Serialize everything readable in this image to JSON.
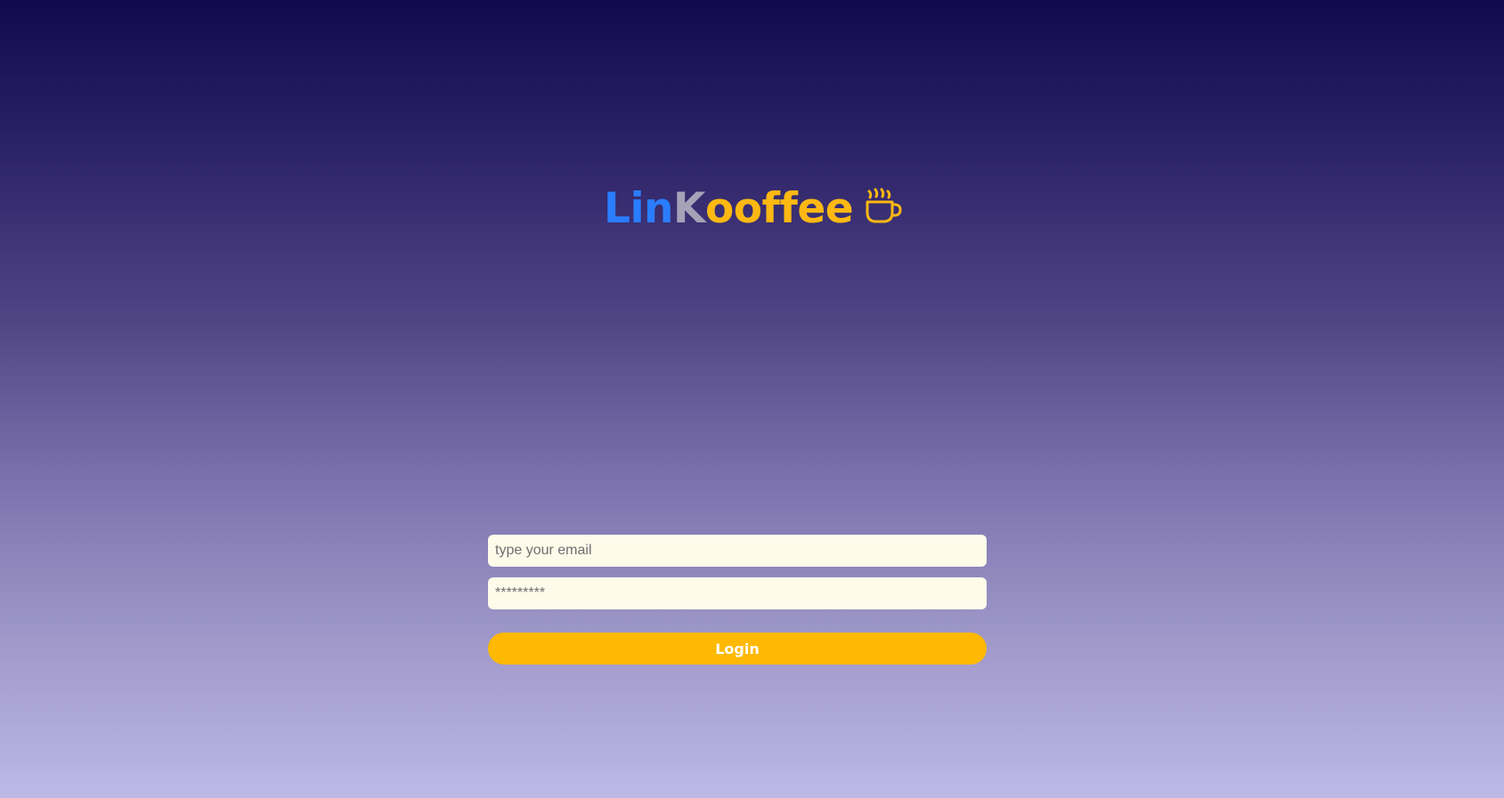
{
  "logo": {
    "part_a": "Lin",
    "part_b": "K",
    "part_c": "ooffee",
    "icon": "coffee-cup-icon",
    "colors": {
      "part_a": "#2a7dff",
      "part_b": "#a6a2b8",
      "part_c": "#fdb813"
    }
  },
  "login_form": {
    "email_placeholder": "type your email",
    "password_placeholder": "*********",
    "login_label": "Login"
  },
  "colors": {
    "accent": "#ffb902",
    "input_background": "#fefbea",
    "background_top": "#110a4f",
    "background_bottom": "#bdb8e6"
  }
}
